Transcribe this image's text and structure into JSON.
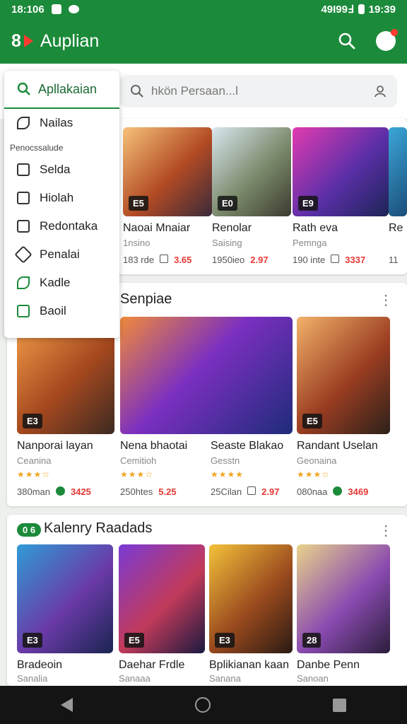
{
  "status": {
    "time": "18:106",
    "right": "49I99Ⅎ",
    "clock": "19:39"
  },
  "appbar": {
    "logo": "8",
    "title": "Auplian"
  },
  "search": {
    "placeholder": "hkön Persaan...l"
  },
  "menu": {
    "header": "Apllakaian",
    "items_top": [
      "Nailas"
    ],
    "subheading": "Penocssalude",
    "items": [
      "Selda",
      "Hiolah",
      "Redontaka",
      "Penalai",
      "Kadle",
      "Baoil"
    ]
  },
  "section1": {
    "tiles": [
      {
        "badge": "E5",
        "name": "Naoai Mnaiar",
        "sub": "1nsino",
        "m1": "183 rde",
        "price": "3.65"
      },
      {
        "badge": "E0",
        "name": "Renolar",
        "sub": "Saising",
        "m1": "1950ieo",
        "price": "2.97"
      },
      {
        "badge": "E9",
        "name": "Rath eva",
        "sub": "Pemnga",
        "m1": "190 inte",
        "price": "3337"
      },
      {
        "badge": "",
        "name": "Re",
        "sub": "",
        "m1": "11",
        "price": ""
      }
    ]
  },
  "section2": {
    "title": "Senpiae",
    "tiles": [
      {
        "badge": "E3",
        "name": "Nanporai layan",
        "sub": "Ceanina",
        "m1": "380man",
        "price": "3425"
      },
      {
        "badge": "",
        "name": "Nena bhaotai",
        "sub": "Cemitioh",
        "m1": "250htes",
        "price": "5.25"
      },
      {
        "badge": "",
        "name": "Seaste Blakao",
        "sub": "Gesstn",
        "m1": "25Cilan",
        "price": "2.97"
      },
      {
        "badge": "E5",
        "name": "Randant Uselan",
        "sub": "Geonaina",
        "m1": "080naa",
        "price": "3469"
      }
    ]
  },
  "section3": {
    "title": "Kalenry Raadads",
    "tag": "0 6",
    "tiles": [
      {
        "badge": "E3",
        "name": "Bradeoin",
        "sub": "Sanalia"
      },
      {
        "badge": "E5",
        "name": "Daehar Frdle",
        "sub": "Sanaaa"
      },
      {
        "badge": "E3",
        "name": "Bplikianan kaan",
        "sub": "Sanana"
      },
      {
        "badge": "28",
        "name": "Danbe Penn",
        "sub": "Sanoan"
      }
    ]
  },
  "colors": {
    "brand": "#1b8a3a",
    "accent": "#ff3b2f"
  }
}
